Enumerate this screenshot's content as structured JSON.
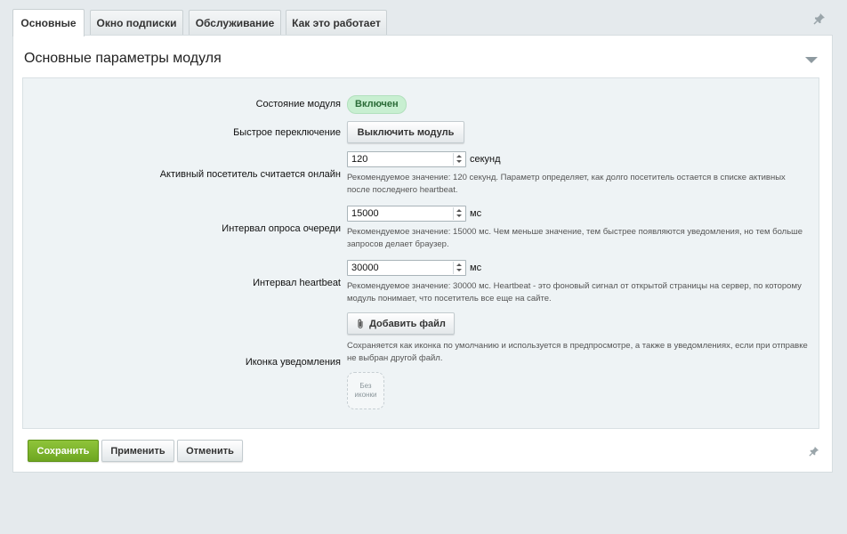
{
  "tabs": [
    {
      "label": "Основные",
      "active": true
    },
    {
      "label": "Окно подписки",
      "active": false
    },
    {
      "label": "Обслуживание",
      "active": false
    },
    {
      "label": "Как это работает",
      "active": false
    }
  ],
  "section": {
    "title": "Основные параметры модуля"
  },
  "fields": {
    "status": {
      "label": "Состояние модуля",
      "value": "Включен"
    },
    "toggle": {
      "label": "Быстрое переключение",
      "button": "Выключить модуль"
    },
    "online": {
      "label": "Активный посетитель считается онлайн",
      "value": "120",
      "unit": "секунд",
      "hint": "Рекомендуемое значение: 120 секунд. Параметр определяет, как долго посетитель остается в списке активных после последнего heartbeat."
    },
    "poll": {
      "label": "Интервал опроса очереди",
      "value": "15000",
      "unit": "мс",
      "hint": "Рекомендуемое значение: 15000 мс. Чем меньше значение, тем быстрее появляются уведомления, но тем больше запросов делает браузер."
    },
    "heartbeat": {
      "label": "Интервал heartbeat",
      "value": "30000",
      "unit": "мс",
      "hint": "Рекомендуемое значение: 30000 мс. Heartbeat - это фоновый сигнал от открытой страницы на сервер, по которому модуль понимает, что посетитель все еще на сайте."
    },
    "icon": {
      "label": "Иконка уведомления",
      "button": "Добавить файл",
      "hint": "Сохраняется как иконка по умолчанию и используется в предпросмотре, а также в уведомлениях, если при отправке не выбран другой файл.",
      "placeholder_line1": "Без",
      "placeholder_line2": "иконки"
    }
  },
  "footer": {
    "save": "Сохранить",
    "apply": "Применить",
    "cancel": "Отменить"
  },
  "colors": {
    "save_button": "#7ab52b",
    "status_badge": "#c8efd1",
    "background": "#e5eaed"
  }
}
